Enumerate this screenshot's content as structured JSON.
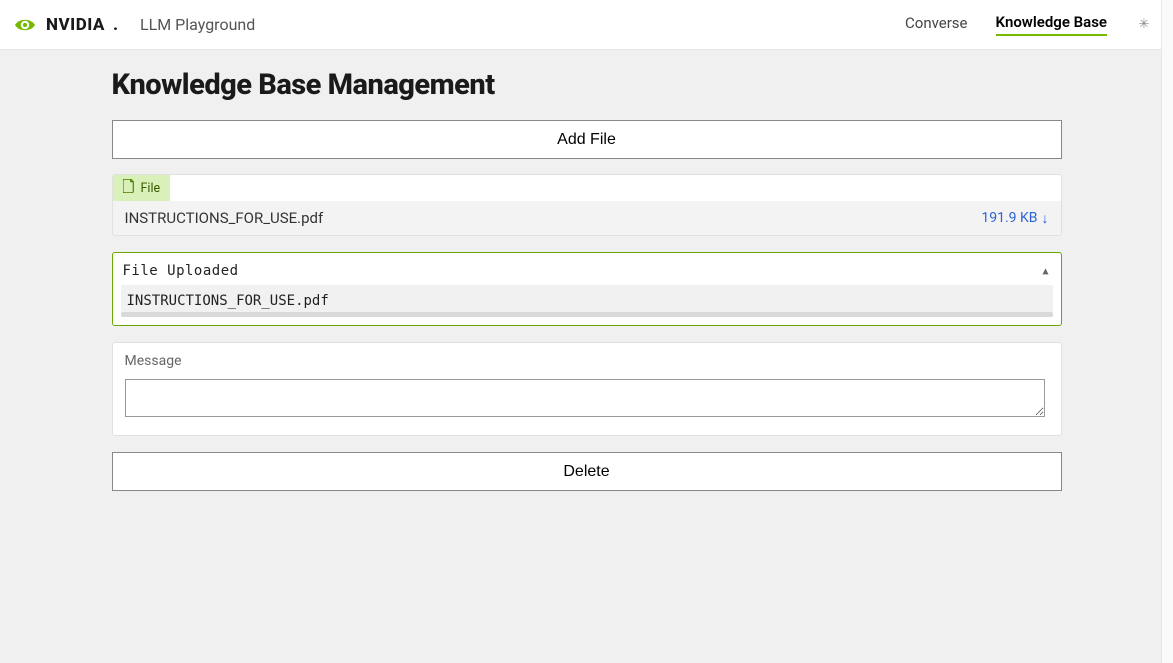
{
  "header": {
    "brand_word": "NVIDIA",
    "brand_dot": ".",
    "app_title": "LLM Playground",
    "nav": {
      "converse": "Converse",
      "knowledge_base": "Knowledge Base"
    }
  },
  "main": {
    "page_title": "Knowledge Base Management",
    "add_file_label": "Add File",
    "file_chip_label": "File",
    "file": {
      "name": "INSTRUCTIONS_FOR_USE.pdf",
      "size": "191.9 KB"
    },
    "status": {
      "heading": "File Uploaded",
      "body": "INSTRUCTIONS_FOR_USE.pdf"
    },
    "message_label": "Message",
    "message_value": "",
    "delete_label": "Delete"
  },
  "icons": {
    "file_icon": "file-icon",
    "download_icon": "download-arrow-icon",
    "collapse_icon": "caret-up-icon",
    "sun_icon": "sun-icon",
    "nvidia_eye": "nvidia-eye-logo"
  },
  "colors": {
    "accent_green": "#76b900",
    "link_blue": "#2b63d9",
    "chip_bg": "#d9f0b8",
    "border_green": "#6aa800"
  }
}
